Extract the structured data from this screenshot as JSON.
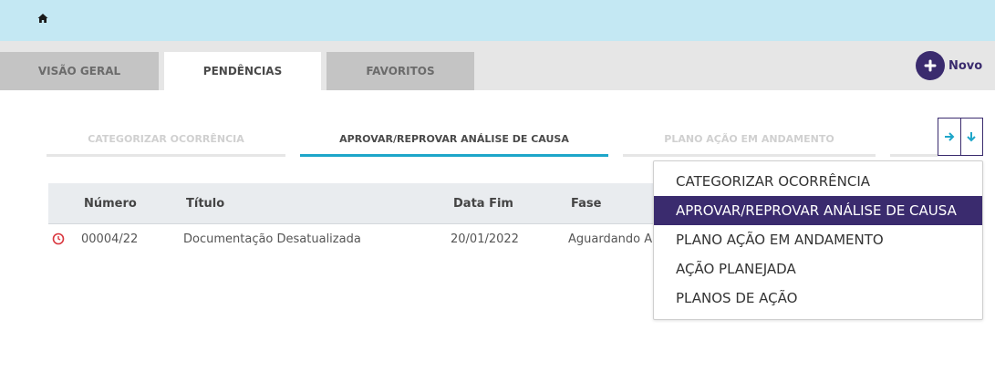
{
  "header": {
    "home_icon": "home-icon",
    "background": "#c4e8f3"
  },
  "tabs": [
    {
      "label": "VISÃO GERAL",
      "active": false
    },
    {
      "label": "PENDÊNCIAS",
      "active": true
    },
    {
      "label": "FAVORITOS",
      "active": false
    }
  ],
  "novo_button": {
    "label": "Novo",
    "icon": "plus-icon",
    "color": "#3a2b6e"
  },
  "subtabs": [
    {
      "label": "CATEGORIZAR OCORRÊNCIA",
      "active": false
    },
    {
      "label": "APROVAR/REPROVAR ANÁLISE DE CAUSA",
      "active": true
    },
    {
      "label": "PLANO AÇÃO EM ANDAMENTO",
      "active": false
    },
    {
      "label": "",
      "active": false
    }
  ],
  "subtab_controls": {
    "next_icon": "arrow-right-icon",
    "dropdown_icon": "arrow-down-icon"
  },
  "table": {
    "columns": [
      "Número",
      "Título",
      "Data Fim",
      "Fase"
    ],
    "rows": [
      {
        "status_icon": "clock-icon",
        "numero": "00004/22",
        "titulo": "Documentação Desatualizada",
        "data_fim": "20/01/2022",
        "fase": "Aguardando A"
      }
    ]
  },
  "dropdown": {
    "items": [
      "CATEGORIZAR OCORRÊNCIA",
      "APROVAR/REPROVAR ANÁLISE DE CAUSA",
      "PLANO AÇÃO EM ANDAMENTO",
      "AÇÃO PLANEJADA",
      "PLANOS DE AÇÃO"
    ],
    "selected": "APROVAR/REPROVAR ANÁLISE DE CAUSA"
  },
  "colors": {
    "accent": "#3a2b6e",
    "active_underline": "#1ea6c9",
    "status_red": "#d9363e",
    "arrow_blue": "#1ea6c9"
  }
}
